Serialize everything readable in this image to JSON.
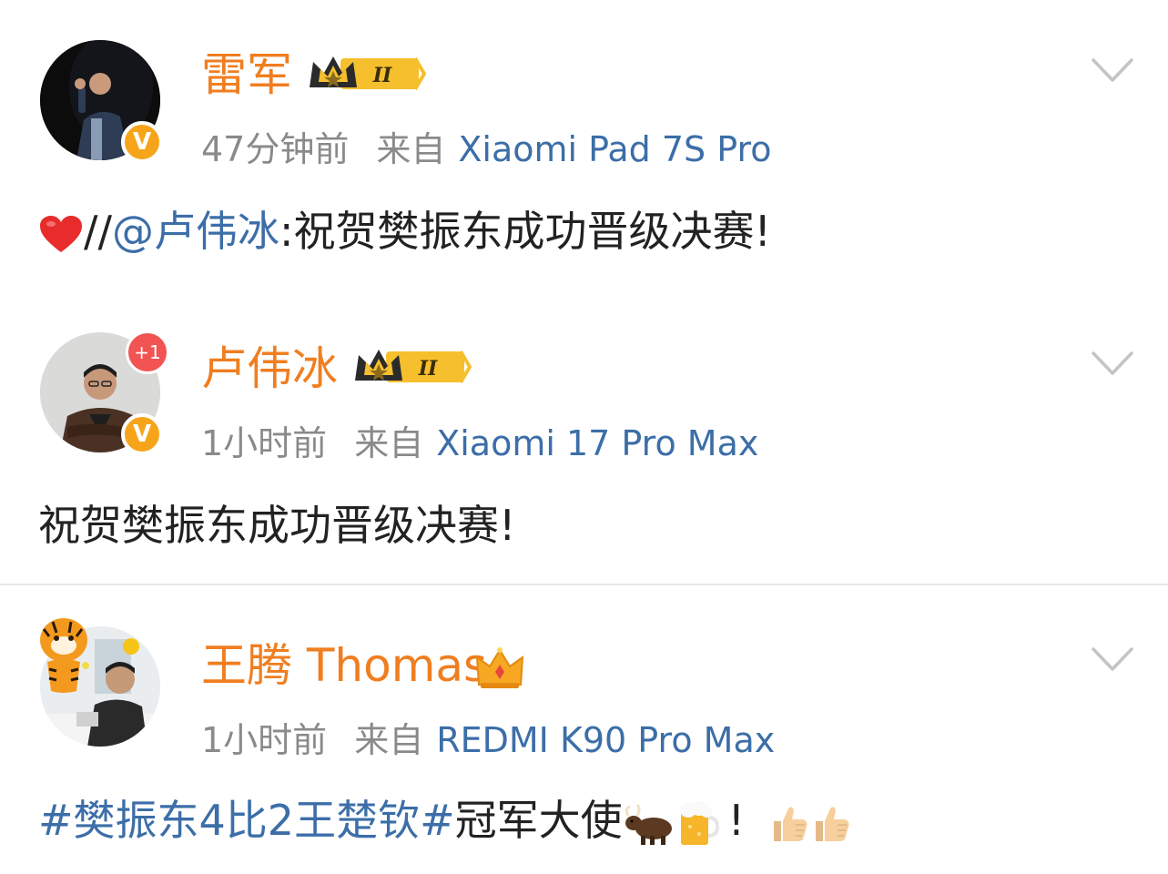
{
  "posts": [
    {
      "username": "雷军",
      "badge_level": "II",
      "time": "47分钟前",
      "from_label": "来自",
      "device": "Xiaomi Pad 7S Pro",
      "verified_mark": "V",
      "content": {
        "emoji": "heart",
        "prefix": "//",
        "mention": "@卢伟冰",
        "text": ":祝贺樊振东成功晋级决赛!"
      }
    },
    {
      "username": "卢伟冰",
      "badge_level": "II",
      "time": "1小时前",
      "from_label": "来自",
      "device": "Xiaomi 17 Pro Max",
      "verified_mark": "V",
      "plus_badge": "+1",
      "content": {
        "text": "祝贺樊振东成功晋级决赛!"
      }
    },
    {
      "username": "王腾 Thomas",
      "time": "1小时前",
      "from_label": "来自",
      "device": "REDMI K90 Pro Max",
      "content": {
        "hashtag": "#樊振东4比2王楚钦#",
        "text": "冠军大使",
        "emojis": [
          "ox",
          "beer"
        ],
        "exclaim": "!",
        "trailing_emojis": [
          "thumbs-up",
          "thumbs-up"
        ]
      }
    }
  ],
  "colors": {
    "username": "#f07e20",
    "link": "#3c6ea8",
    "meta": "#8a8a8a",
    "text": "#222222",
    "verified": "#f6a51a",
    "notification": "#f25353"
  }
}
